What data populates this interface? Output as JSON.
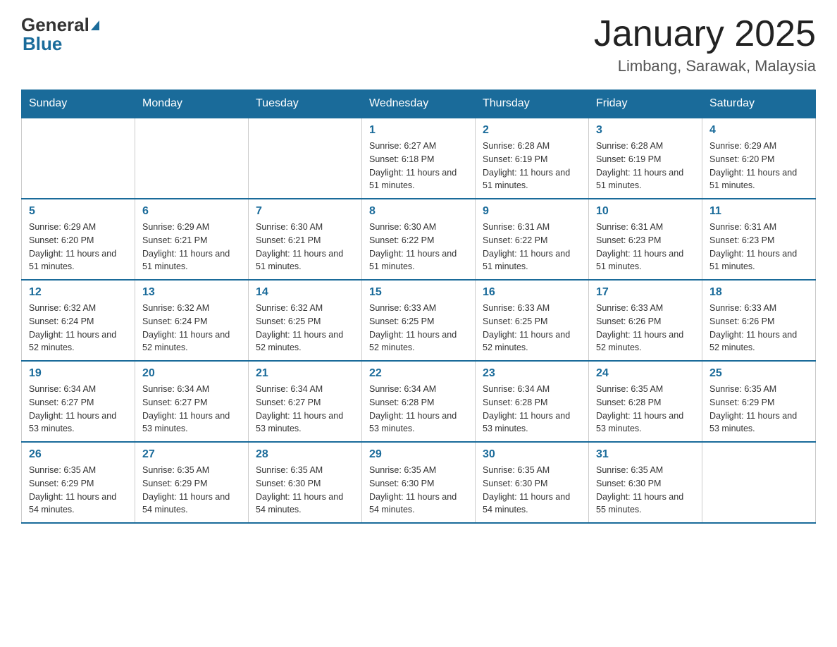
{
  "header": {
    "logo_general": "General",
    "logo_blue": "Blue",
    "month_title": "January 2025",
    "location": "Limbang, Sarawak, Malaysia"
  },
  "weekdays": [
    "Sunday",
    "Monday",
    "Tuesday",
    "Wednesday",
    "Thursday",
    "Friday",
    "Saturday"
  ],
  "weeks": [
    [
      {
        "day": "",
        "info": ""
      },
      {
        "day": "",
        "info": ""
      },
      {
        "day": "",
        "info": ""
      },
      {
        "day": "1",
        "info": "Sunrise: 6:27 AM\nSunset: 6:18 PM\nDaylight: 11 hours and 51 minutes."
      },
      {
        "day": "2",
        "info": "Sunrise: 6:28 AM\nSunset: 6:19 PM\nDaylight: 11 hours and 51 minutes."
      },
      {
        "day": "3",
        "info": "Sunrise: 6:28 AM\nSunset: 6:19 PM\nDaylight: 11 hours and 51 minutes."
      },
      {
        "day": "4",
        "info": "Sunrise: 6:29 AM\nSunset: 6:20 PM\nDaylight: 11 hours and 51 minutes."
      }
    ],
    [
      {
        "day": "5",
        "info": "Sunrise: 6:29 AM\nSunset: 6:20 PM\nDaylight: 11 hours and 51 minutes."
      },
      {
        "day": "6",
        "info": "Sunrise: 6:29 AM\nSunset: 6:21 PM\nDaylight: 11 hours and 51 minutes."
      },
      {
        "day": "7",
        "info": "Sunrise: 6:30 AM\nSunset: 6:21 PM\nDaylight: 11 hours and 51 minutes."
      },
      {
        "day": "8",
        "info": "Sunrise: 6:30 AM\nSunset: 6:22 PM\nDaylight: 11 hours and 51 minutes."
      },
      {
        "day": "9",
        "info": "Sunrise: 6:31 AM\nSunset: 6:22 PM\nDaylight: 11 hours and 51 minutes."
      },
      {
        "day": "10",
        "info": "Sunrise: 6:31 AM\nSunset: 6:23 PM\nDaylight: 11 hours and 51 minutes."
      },
      {
        "day": "11",
        "info": "Sunrise: 6:31 AM\nSunset: 6:23 PM\nDaylight: 11 hours and 51 minutes."
      }
    ],
    [
      {
        "day": "12",
        "info": "Sunrise: 6:32 AM\nSunset: 6:24 PM\nDaylight: 11 hours and 52 minutes."
      },
      {
        "day": "13",
        "info": "Sunrise: 6:32 AM\nSunset: 6:24 PM\nDaylight: 11 hours and 52 minutes."
      },
      {
        "day": "14",
        "info": "Sunrise: 6:32 AM\nSunset: 6:25 PM\nDaylight: 11 hours and 52 minutes."
      },
      {
        "day": "15",
        "info": "Sunrise: 6:33 AM\nSunset: 6:25 PM\nDaylight: 11 hours and 52 minutes."
      },
      {
        "day": "16",
        "info": "Sunrise: 6:33 AM\nSunset: 6:25 PM\nDaylight: 11 hours and 52 minutes."
      },
      {
        "day": "17",
        "info": "Sunrise: 6:33 AM\nSunset: 6:26 PM\nDaylight: 11 hours and 52 minutes."
      },
      {
        "day": "18",
        "info": "Sunrise: 6:33 AM\nSunset: 6:26 PM\nDaylight: 11 hours and 52 minutes."
      }
    ],
    [
      {
        "day": "19",
        "info": "Sunrise: 6:34 AM\nSunset: 6:27 PM\nDaylight: 11 hours and 53 minutes."
      },
      {
        "day": "20",
        "info": "Sunrise: 6:34 AM\nSunset: 6:27 PM\nDaylight: 11 hours and 53 minutes."
      },
      {
        "day": "21",
        "info": "Sunrise: 6:34 AM\nSunset: 6:27 PM\nDaylight: 11 hours and 53 minutes."
      },
      {
        "day": "22",
        "info": "Sunrise: 6:34 AM\nSunset: 6:28 PM\nDaylight: 11 hours and 53 minutes."
      },
      {
        "day": "23",
        "info": "Sunrise: 6:34 AM\nSunset: 6:28 PM\nDaylight: 11 hours and 53 minutes."
      },
      {
        "day": "24",
        "info": "Sunrise: 6:35 AM\nSunset: 6:28 PM\nDaylight: 11 hours and 53 minutes."
      },
      {
        "day": "25",
        "info": "Sunrise: 6:35 AM\nSunset: 6:29 PM\nDaylight: 11 hours and 53 minutes."
      }
    ],
    [
      {
        "day": "26",
        "info": "Sunrise: 6:35 AM\nSunset: 6:29 PM\nDaylight: 11 hours and 54 minutes."
      },
      {
        "day": "27",
        "info": "Sunrise: 6:35 AM\nSunset: 6:29 PM\nDaylight: 11 hours and 54 minutes."
      },
      {
        "day": "28",
        "info": "Sunrise: 6:35 AM\nSunset: 6:30 PM\nDaylight: 11 hours and 54 minutes."
      },
      {
        "day": "29",
        "info": "Sunrise: 6:35 AM\nSunset: 6:30 PM\nDaylight: 11 hours and 54 minutes."
      },
      {
        "day": "30",
        "info": "Sunrise: 6:35 AM\nSunset: 6:30 PM\nDaylight: 11 hours and 54 minutes."
      },
      {
        "day": "31",
        "info": "Sunrise: 6:35 AM\nSunset: 6:30 PM\nDaylight: 11 hours and 55 minutes."
      },
      {
        "day": "",
        "info": ""
      }
    ]
  ]
}
